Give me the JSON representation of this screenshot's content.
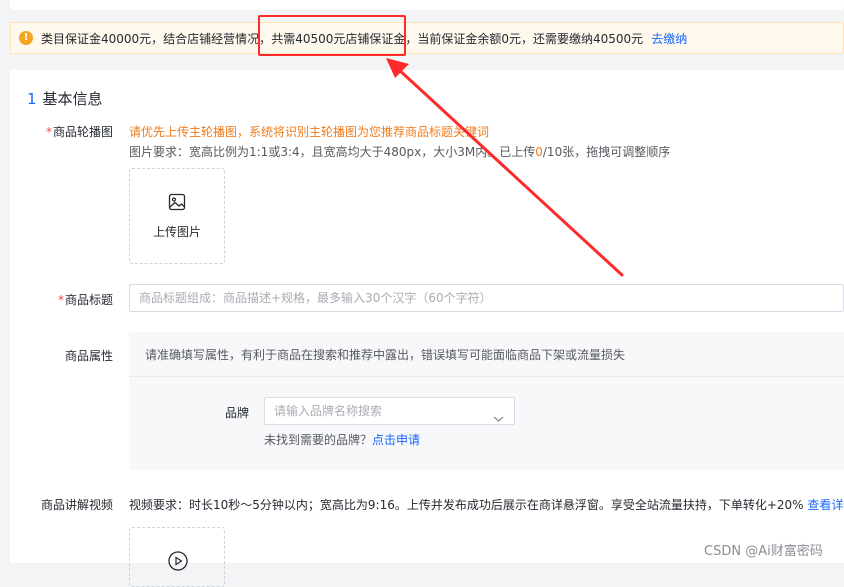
{
  "notice": {
    "text_before": "类目保证金40000元，结合店铺经营情况，",
    "text_highlight": "共需40500元店铺保证金，",
    "text_after": "当前保证金余额0元，还需要缴纳40500元",
    "link": "去缴纳"
  },
  "section": {
    "number": "1",
    "title": "基本信息"
  },
  "main_image": {
    "label": "商品轮播图",
    "required_mark": "*",
    "hint_orange": "请优先上传主轮播图，系统将识别主轮播图为您推荐商品标题关键词",
    "hint_grey_before": "图片要求：宽高比例为1:1或3:4，且宽高均大于480px，大小3M内。已上传",
    "uploaded_count": "0",
    "hint_grey_after": "/10张，拖拽可调整顺序",
    "upload_label": "上传图片",
    "upload_icon": "image-icon"
  },
  "title_field": {
    "label": "商品标题",
    "required_mark": "*",
    "placeholder": "商品标题组成：商品描述+规格，最多输入30个汉字（60个字符）"
  },
  "attributes": {
    "label": "商品属性",
    "hint": "请准确填写属性，有利于商品在搜索和推荐中露出，错误填写可能面临商品下架或流量损失",
    "brand_label": "品牌",
    "brand_placeholder": "请输入品牌名称搜索",
    "brand_help_text": "未找到需要的品牌？",
    "brand_help_link": "点击申请"
  },
  "video": {
    "label": "商品讲解视频",
    "hint": "视频要求：时长10秒～5分钟以内；宽高比为9:16。上传并发布成功后展示在商详悬浮窗。享受全站流量扶持，下单转化+20%",
    "link": "查看详情",
    "upload_icon": "play-icon"
  },
  "watermark": "CSDN @Ai财富密码",
  "colors": {
    "accent": "#1966ff",
    "warning": "#f5a623",
    "orange_text": "#f07c1d",
    "annotation_red": "#ff2a2a",
    "required": "#ff4050"
  }
}
